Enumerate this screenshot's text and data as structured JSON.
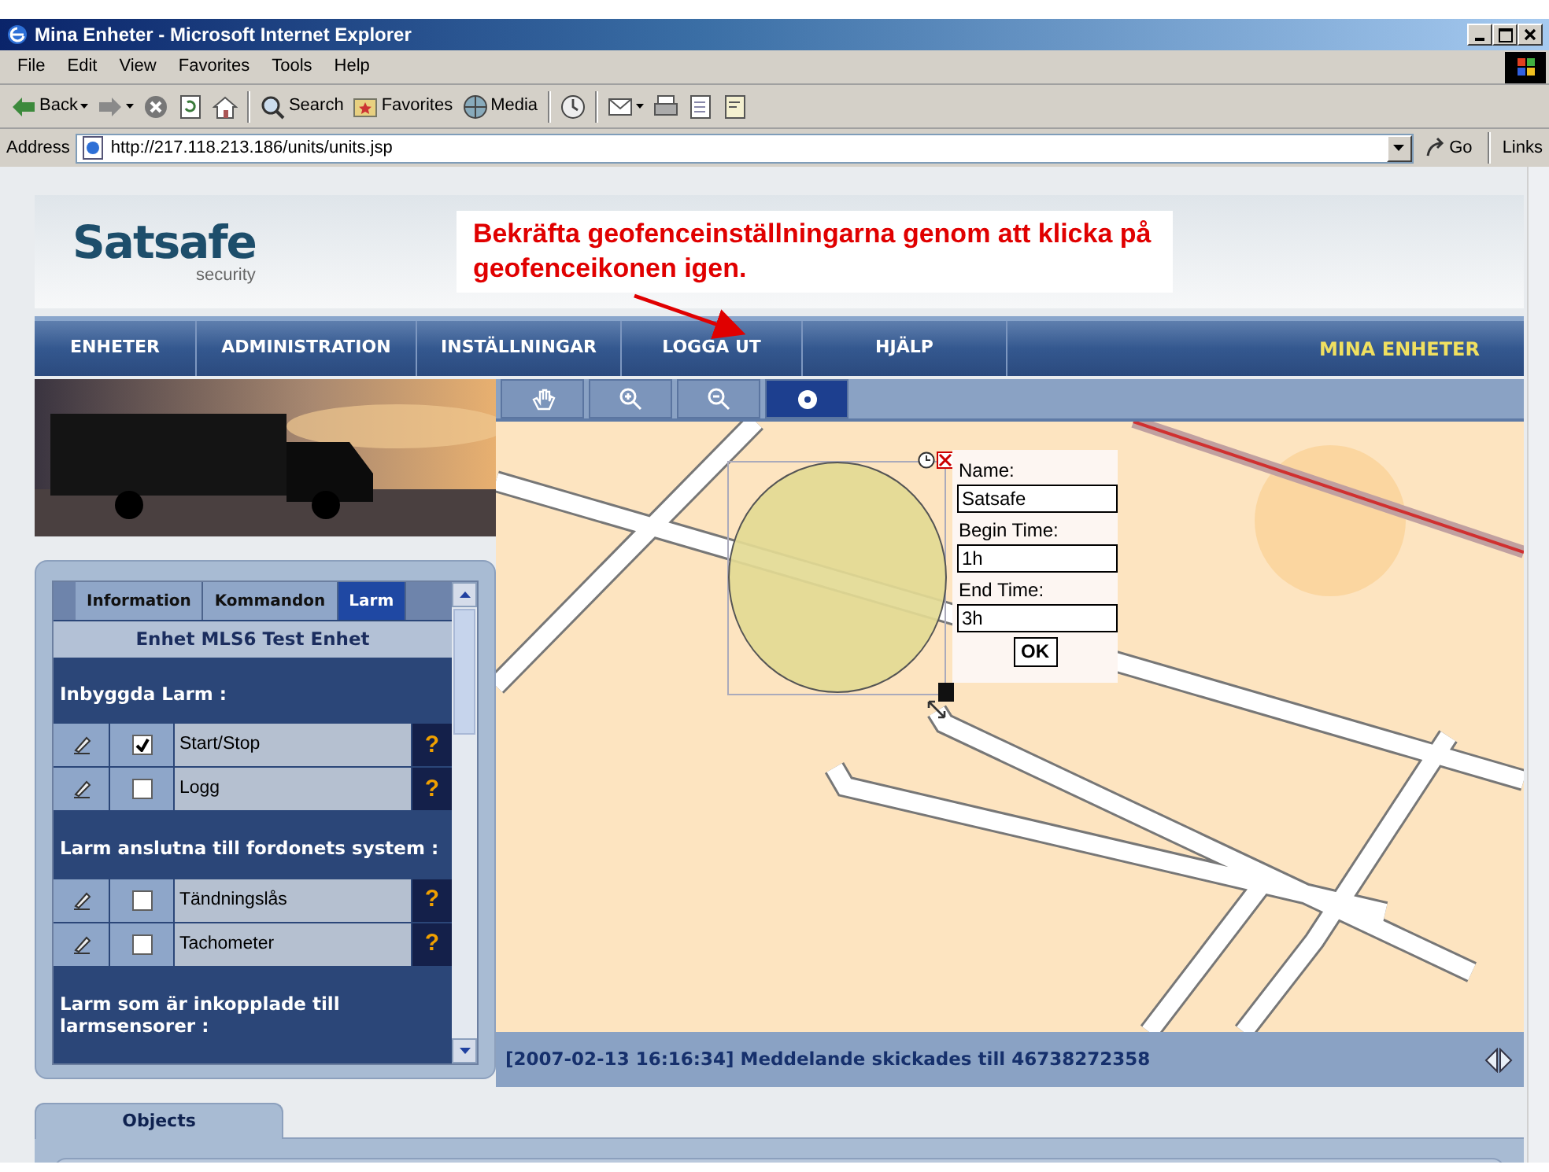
{
  "window": {
    "title": "Mina Enheter - Microsoft Internet Explorer"
  },
  "menu": [
    "File",
    "Edit",
    "View",
    "Favorites",
    "Tools",
    "Help"
  ],
  "toolbar": [
    {
      "kind": "back",
      "label": "Back",
      "dropdown": true
    },
    {
      "kind": "forward",
      "dropdown": true
    },
    {
      "kind": "stop"
    },
    {
      "kind": "refresh"
    },
    {
      "kind": "home"
    },
    {
      "kind": "search",
      "label": "Search"
    },
    {
      "kind": "favorites",
      "label": "Favorites"
    },
    {
      "kind": "media",
      "label": "Media"
    },
    {
      "kind": "history"
    },
    {
      "kind": "mail",
      "dropdown": true
    },
    {
      "kind": "print"
    },
    {
      "kind": "edit"
    },
    {
      "kind": "discuss"
    }
  ],
  "address": {
    "label": "Address",
    "value": "http://217.118.213.186/units/units.jsp",
    "go": "Go",
    "links": "Links"
  },
  "site": {
    "logo": "Satsafe",
    "logo_sub": "security"
  },
  "callout": "Bekräfta geofenceinställningarna genom att klicka på geofenceikonen igen.",
  "nav": [
    "ENHETER",
    "ADMINISTRATION",
    "INSTÄLLNINGAR",
    "LOGGA UT",
    "HJÄLP"
  ],
  "nav_title": "MINA ENHETER",
  "map_tools": [
    {
      "kind": "pan",
      "selected": false
    },
    {
      "kind": "zoom-in",
      "selected": false
    },
    {
      "kind": "zoom-out",
      "selected": false
    },
    {
      "kind": "geofence",
      "selected": true
    }
  ],
  "geofence": {
    "fields": [
      {
        "label": "Name:",
        "value": "Satsafe"
      },
      {
        "label": "Begin Time:",
        "value": "1h"
      },
      {
        "label": "End Time:",
        "value": "3h"
      }
    ],
    "button": "OK"
  },
  "panel": {
    "tabs": [
      {
        "label": "Information",
        "selected": false
      },
      {
        "label": "Kommandon",
        "selected": false
      },
      {
        "label": "Larm",
        "selected": true
      }
    ],
    "heading": "Enhet MLS6 Test Enhet",
    "sections": [
      {
        "title": "Inbyggda Larm :",
        "alarms": [
          {
            "label": "Start/Stop",
            "checked": true,
            "help": "?"
          },
          {
            "label": "Logg",
            "checked": false,
            "help": "?"
          }
        ]
      },
      {
        "title": "Larm anslutna till fordonets system :",
        "alarms": [
          {
            "label": "Tändningslås",
            "checked": false,
            "help": "?"
          },
          {
            "label": "Tachometer",
            "checked": false,
            "help": "?"
          }
        ]
      },
      {
        "title": "Larm som är inkopplade till larmsensorer :"
      }
    ]
  },
  "status": "[2007-02-13 16:16:34] Meddelande skickades till 46738272358",
  "bottom_tabs": [
    {
      "label": "Objects",
      "selected": true
    }
  ]
}
